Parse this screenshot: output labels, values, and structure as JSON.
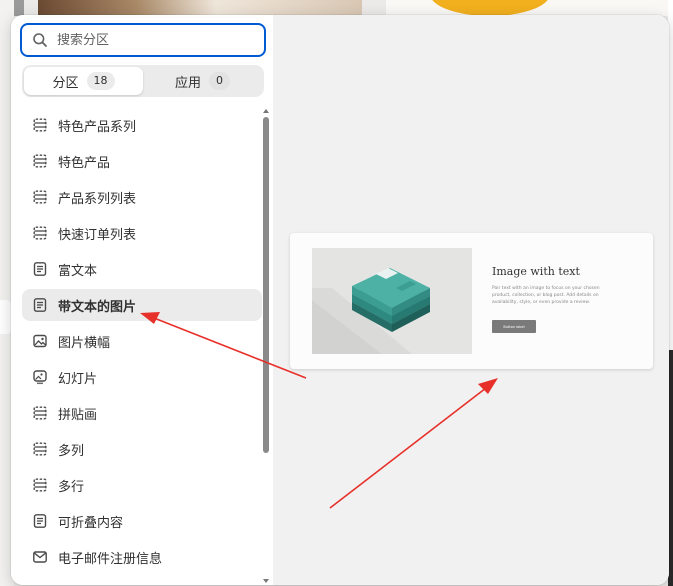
{
  "search": {
    "placeholder": "搜索分区",
    "value": ""
  },
  "tabs": [
    {
      "label": "分区",
      "count": "18",
      "active": true
    },
    {
      "label": "应用",
      "count": "0",
      "active": false
    }
  ],
  "sections": [
    {
      "label": "特色产品系列",
      "icon": "collection-icon"
    },
    {
      "label": "特色产品",
      "icon": "collection-icon"
    },
    {
      "label": "产品系列列表",
      "icon": "collection-icon"
    },
    {
      "label": "快速订单列表",
      "icon": "collection-icon"
    },
    {
      "label": "富文本",
      "icon": "text-block-icon"
    },
    {
      "label": "带文本的图片",
      "icon": "text-block-icon",
      "selected": true
    },
    {
      "label": "图片横幅",
      "icon": "image-icon"
    },
    {
      "label": "幻灯片",
      "icon": "slideshow-icon"
    },
    {
      "label": "拼贴画",
      "icon": "collection-icon"
    },
    {
      "label": "多列",
      "icon": "collection-icon"
    },
    {
      "label": "多行",
      "icon": "collection-icon"
    },
    {
      "label": "可折叠内容",
      "icon": "text-block-icon"
    },
    {
      "label": "电子邮件注册信息",
      "icon": "email-icon"
    }
  ],
  "preview": {
    "title": "Image with text",
    "body": "Pair text with an image to focus on your chosen product, collection, or blog post. Add details on availability, style, or even provide a review.",
    "button": "Button label"
  },
  "colors": {
    "focus": "#005bd3",
    "arrow": "#e8302a",
    "panel": "#f1f1f1"
  }
}
